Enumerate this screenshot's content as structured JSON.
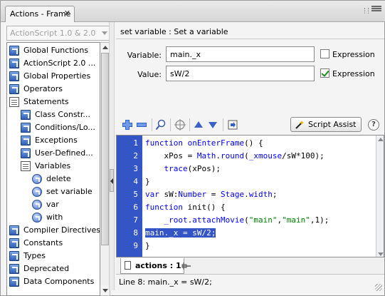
{
  "panel": {
    "tab_title": "Actions - Frame",
    "close_glyph": "✕"
  },
  "left": {
    "version": "ActionScript 1.0 & 2.0",
    "tree": [
      {
        "label": "Global Functions",
        "icon": "book-icon",
        "indent": 0
      },
      {
        "label": "ActionScript 2.0 ...",
        "icon": "book-icon",
        "indent": 0
      },
      {
        "label": "Global Properties",
        "icon": "book-icon",
        "indent": 0
      },
      {
        "label": "Operators",
        "icon": "book-icon",
        "indent": 0
      },
      {
        "label": "Statements",
        "icon": "open-book-icon",
        "indent": 0
      },
      {
        "label": "Class Constr...",
        "icon": "book-icon",
        "indent": 1
      },
      {
        "label": "Conditions/Lo...",
        "icon": "book-icon",
        "indent": 1
      },
      {
        "label": "Exceptions",
        "icon": "book-icon",
        "indent": 1
      },
      {
        "label": "User-Defined...",
        "icon": "book-icon",
        "indent": 1
      },
      {
        "label": "Variables",
        "icon": "open-book-icon",
        "indent": 1
      },
      {
        "label": "delete",
        "icon": "action-icon",
        "indent": 2
      },
      {
        "label": "set variable",
        "icon": "action-icon",
        "indent": 2
      },
      {
        "label": "var",
        "icon": "action-icon",
        "indent": 2
      },
      {
        "label": "with",
        "icon": "action-icon",
        "indent": 2
      },
      {
        "label": "Compiler Directives",
        "icon": "book-icon",
        "indent": 0
      },
      {
        "label": "Constants",
        "icon": "book-icon",
        "indent": 0
      },
      {
        "label": "Types",
        "icon": "book-icon",
        "indent": 0
      },
      {
        "label": "Deprecated",
        "icon": "book-icon",
        "indent": 0
      },
      {
        "label": "Data Components",
        "icon": "book-icon",
        "indent": 0
      }
    ]
  },
  "right": {
    "description": "set variable : Set a variable",
    "variable_label": "Variable:",
    "variable_value": "main._x",
    "value_label": "Value:",
    "value_value": "sW/2",
    "expression_label_1": "Expression",
    "expression_label_2": "Expression",
    "expression_1_checked": false,
    "expression_2_checked": true,
    "script_assist_label": "Script Assist",
    "help_glyph": "?"
  },
  "code": {
    "line_numbers": [
      "1",
      "2",
      "3",
      "4",
      "5",
      "6",
      "7",
      "8",
      "9"
    ],
    "lines": [
      [
        {
          "t": "function ",
          "c": "kw"
        },
        {
          "t": "onEnterFrame",
          "c": "kw"
        },
        {
          "t": "() {",
          "c": ""
        }
      ],
      [
        {
          "t": "    xPos = ",
          "c": ""
        },
        {
          "t": "Math",
          "c": "kw"
        },
        {
          "t": ".",
          "c": ""
        },
        {
          "t": "round",
          "c": "kw"
        },
        {
          "t": "(",
          "c": ""
        },
        {
          "t": "_xmouse",
          "c": "kw"
        },
        {
          "t": "/sW*100);",
          "c": ""
        }
      ],
      [
        {
          "t": "    ",
          "c": ""
        },
        {
          "t": "trace",
          "c": "kw"
        },
        {
          "t": "(xPos);",
          "c": ""
        }
      ],
      [
        {
          "t": "}",
          "c": ""
        }
      ],
      [
        {
          "t": "var ",
          "c": "kw"
        },
        {
          "t": "sW:",
          "c": ""
        },
        {
          "t": "Number",
          "c": "kw"
        },
        {
          "t": " = ",
          "c": ""
        },
        {
          "t": "Stage",
          "c": "kw"
        },
        {
          "t": ".",
          "c": ""
        },
        {
          "t": "width",
          "c": "kw"
        },
        {
          "t": ";",
          "c": ""
        }
      ],
      [
        {
          "t": "function ",
          "c": "kw"
        },
        {
          "t": "init() {",
          "c": ""
        }
      ],
      [
        {
          "t": "    ",
          "c": ""
        },
        {
          "t": "_root",
          "c": "kw"
        },
        {
          "t": ".",
          "c": ""
        },
        {
          "t": "attachMovie",
          "c": "kw"
        },
        {
          "t": "(",
          "c": ""
        },
        {
          "t": "\"main\"",
          "c": "str"
        },
        {
          "t": ",",
          "c": ""
        },
        {
          "t": "\"main\"",
          "c": "str"
        },
        {
          "t": ",1);",
          "c": ""
        }
      ],
      [
        {
          "t": "main._x = sW/2;",
          "c": "sel"
        }
      ],
      [
        {
          "t": "}",
          "c": ""
        }
      ]
    ]
  },
  "bottom": {
    "tab_label": "actions : 1",
    "status": "Line 8: main._x = sW/2;"
  }
}
